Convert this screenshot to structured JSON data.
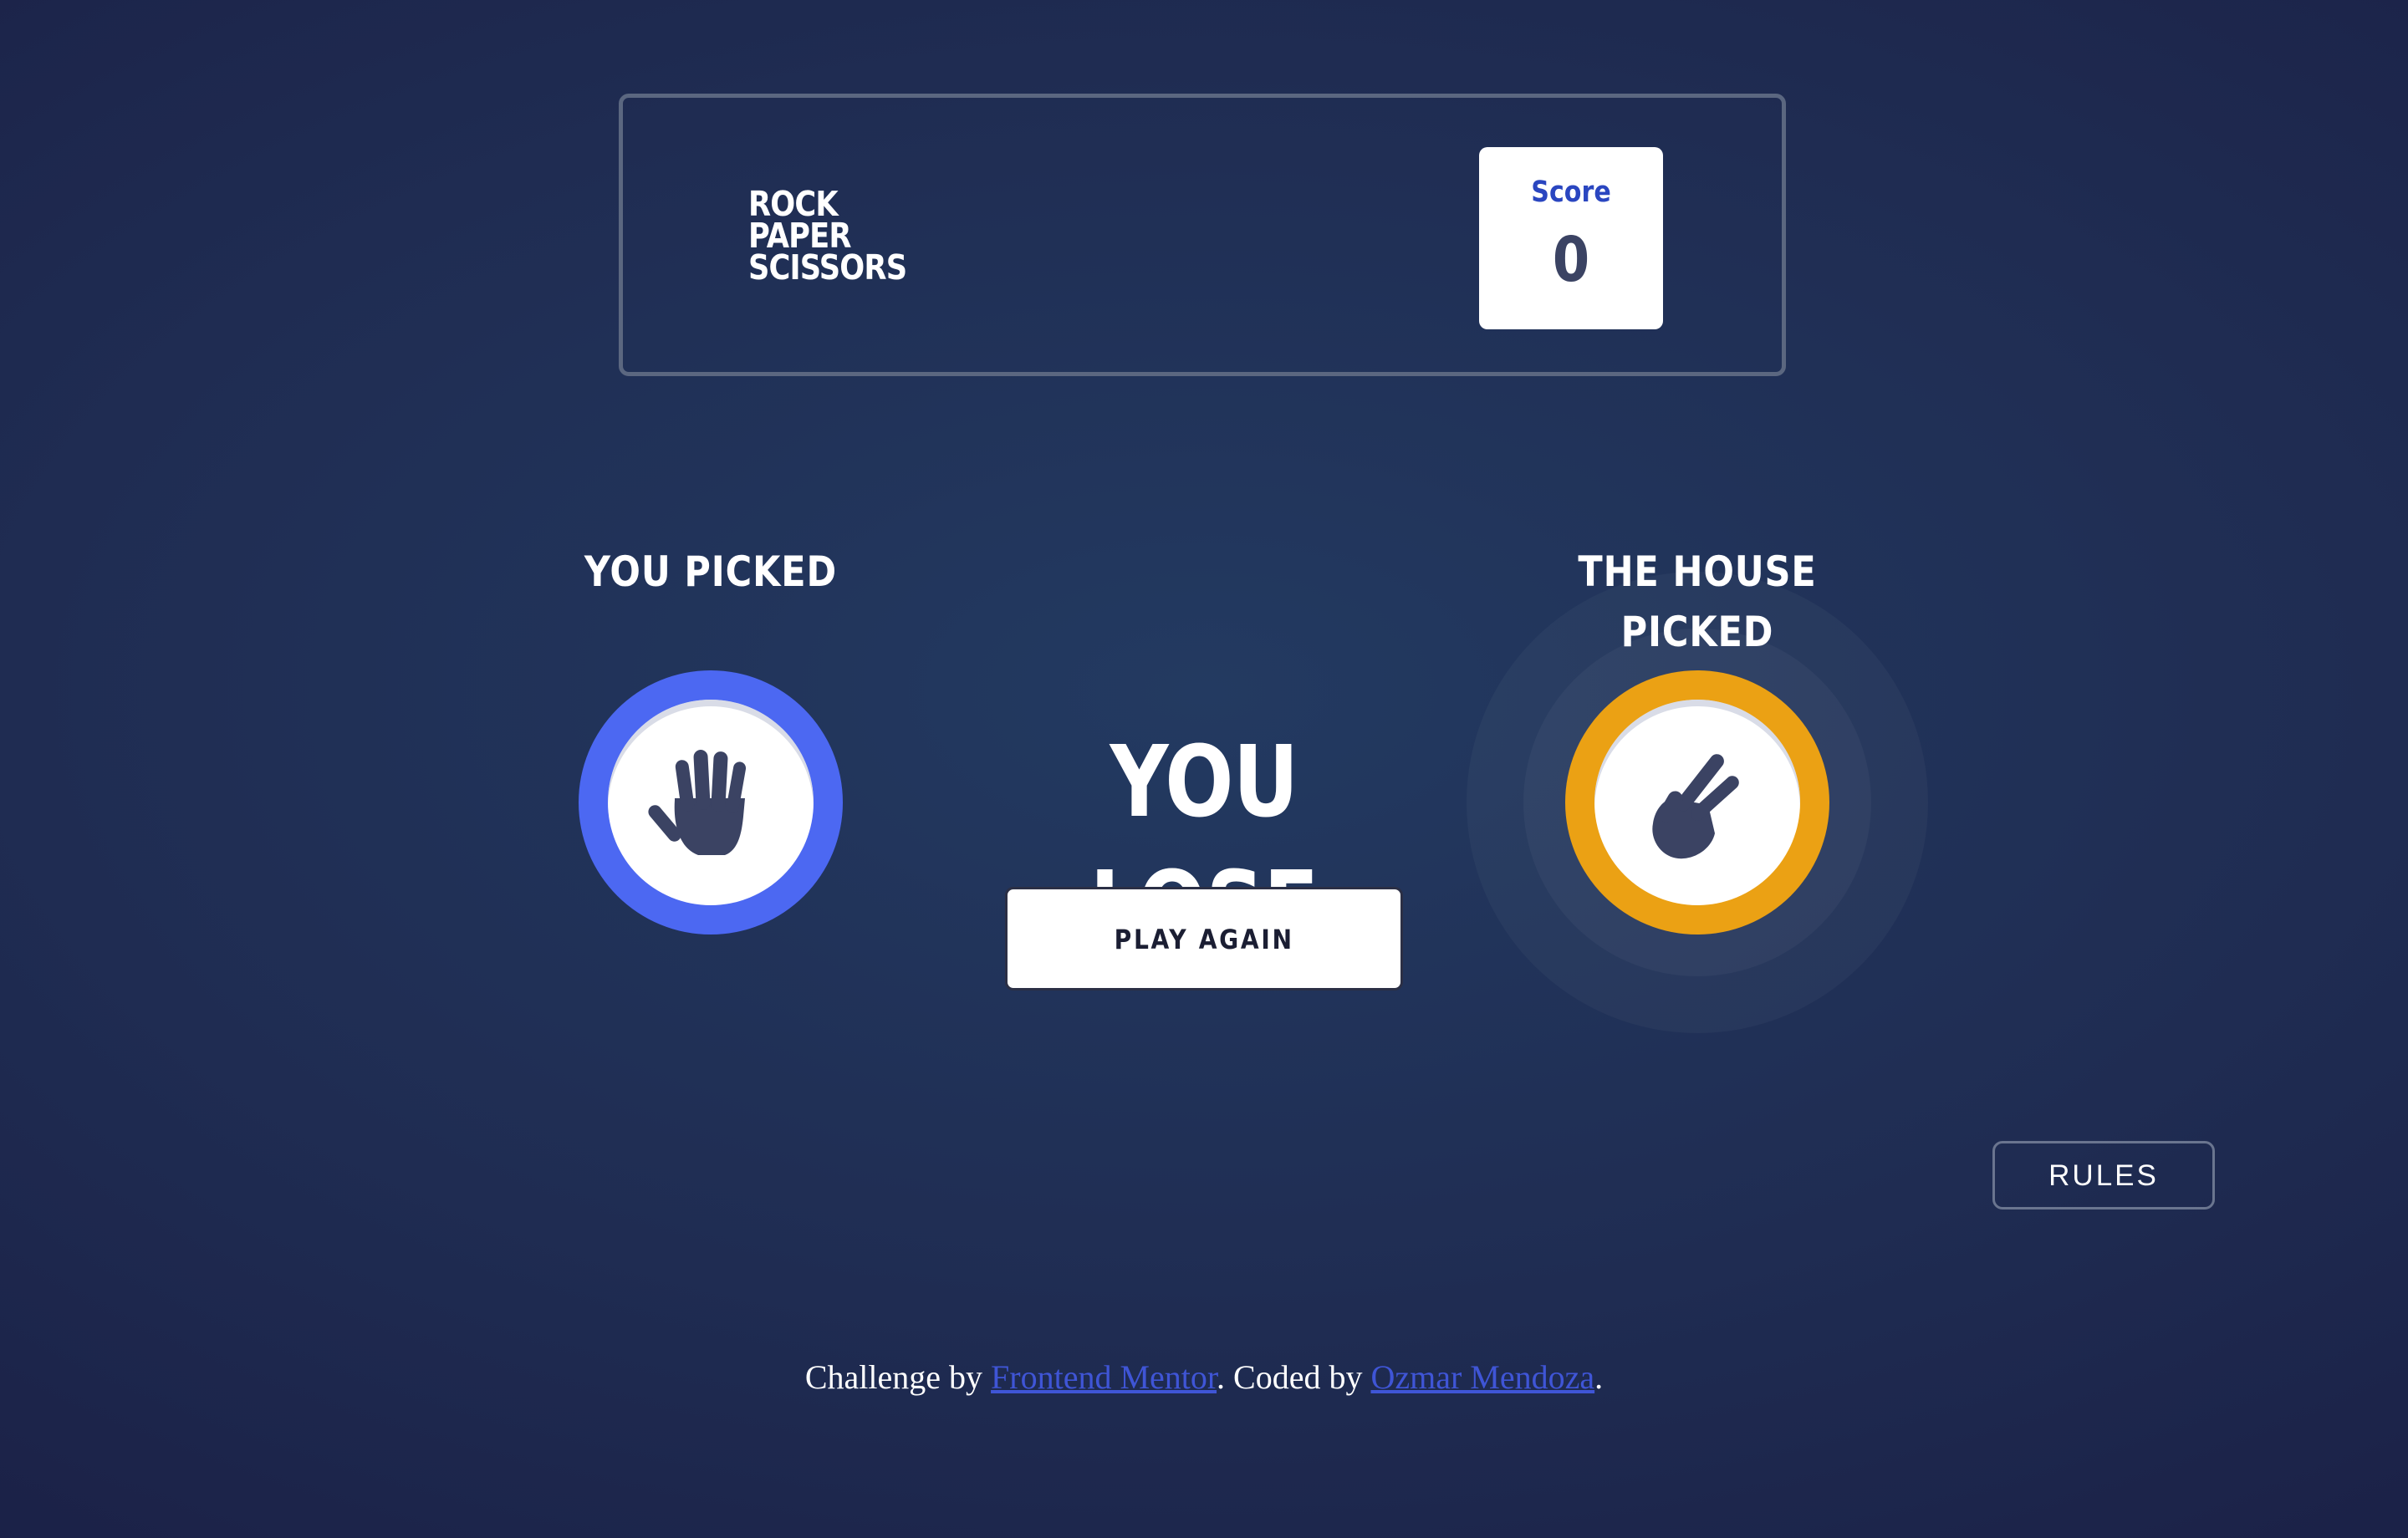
{
  "app": {
    "logo_lines": [
      "ROCK",
      "PAPER",
      "SCISSORS"
    ]
  },
  "score": {
    "label": "Score",
    "value": "0"
  },
  "game": {
    "you_label": "YOU PICKED",
    "house_label_line1": "THE HOUSE",
    "house_label_line2": "PICKED",
    "you_pick": "paper",
    "house_pick": "scissors",
    "result": "YOU LOSE",
    "play_again_label": "PLAY AGAIN"
  },
  "rules": {
    "label": "RULES"
  },
  "footer": {
    "prefix": "Challenge by ",
    "link1": "Frontend Mentor",
    "middle": ". Coded by ",
    "link2": "Ozmar Mendoza",
    "suffix": "."
  },
  "colors": {
    "paper": "#4c68f2",
    "scissors": "#eba114",
    "icon": "#3b4363",
    "score_label": "#2a46c0"
  },
  "icons": {
    "paper": "hand-open-icon",
    "scissors": "hand-scissors-icon"
  }
}
